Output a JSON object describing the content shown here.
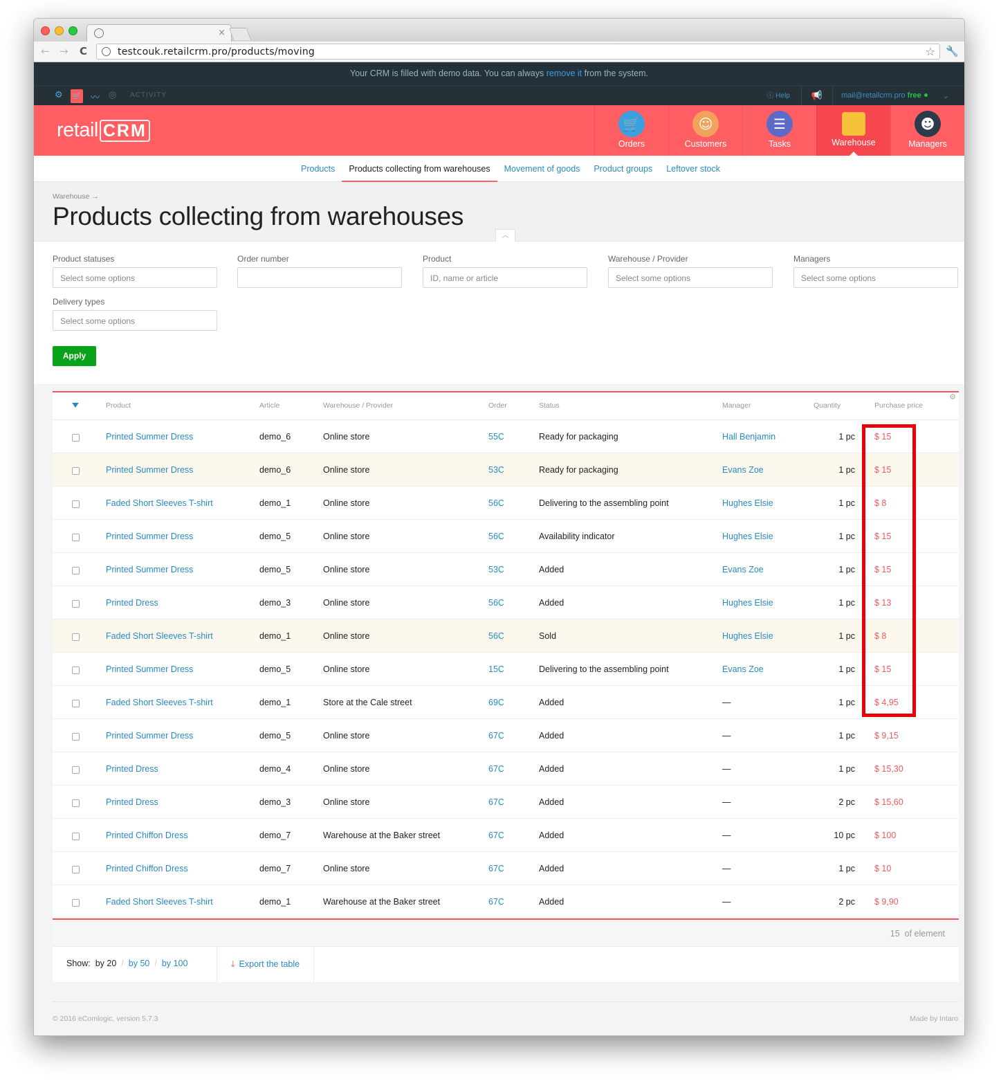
{
  "browser": {
    "url": "testcouk.retailcrm.pro/products/moving",
    "tab_close": "×"
  },
  "demo_banner": {
    "text_before": "Your CRM is filled with demo data. You can always ",
    "link": "remove it",
    "text_after": " from the system."
  },
  "topbar": {
    "activity": "ACTIVITY",
    "help": "Help",
    "user_email": "mail@retailcrm.pro",
    "plan": "free"
  },
  "header": {
    "logo_text": "retail",
    "logo_crm": "CRM",
    "nav": [
      {
        "label": "Orders",
        "icon": "cart-icon"
      },
      {
        "label": "Customers",
        "icon": "customer-avatar-icon"
      },
      {
        "label": "Tasks",
        "icon": "tasks-icon"
      },
      {
        "label": "Warehouse",
        "icon": "box-icon",
        "active": true
      },
      {
        "label": "Managers",
        "icon": "manager-avatar-icon"
      }
    ]
  },
  "subnav": [
    {
      "label": "Products"
    },
    {
      "label": "Products collecting from warehouses",
      "active": true
    },
    {
      "label": "Movement of goods"
    },
    {
      "label": "Product groups"
    },
    {
      "label": "Leftover stock"
    }
  ],
  "page": {
    "breadcrumb": "Warehouse →",
    "title": "Products collecting from warehouses"
  },
  "filters": {
    "product_statuses": {
      "label": "Product statuses",
      "placeholder": "Select some options"
    },
    "order_number": {
      "label": "Order number",
      "placeholder": ""
    },
    "product": {
      "label": "Product",
      "placeholder": "ID, name or article"
    },
    "warehouse": {
      "label": "Warehouse / Provider",
      "placeholder": "Select some options"
    },
    "managers": {
      "label": "Managers",
      "placeholder": "Select some options"
    },
    "delivery_types": {
      "label": "Delivery types",
      "placeholder": "Select some options"
    },
    "apply": "Apply"
  },
  "table": {
    "headers": {
      "product": "Product",
      "article": "Article",
      "warehouse": "Warehouse / Provider",
      "order": "Order",
      "status": "Status",
      "manager": "Manager",
      "quantity": "Quantity",
      "price": "Purchase price"
    },
    "rows": [
      {
        "product": "Printed Summer Dress",
        "article": "demo_6",
        "warehouse": "Online store",
        "order": "55C",
        "status": "Ready for packaging",
        "manager": "Hall Benjamin",
        "quantity": "1 pc",
        "price": "$ 15"
      },
      {
        "product": "Printed Summer Dress",
        "article": "demo_6",
        "warehouse": "Online store",
        "order": "53C",
        "status": "Ready for packaging",
        "manager": "Evans Zoe",
        "quantity": "1 pc",
        "price": "$ 15"
      },
      {
        "product": "Faded Short Sleeves T-shirt",
        "article": "demo_1",
        "warehouse": "Online store",
        "order": "56C",
        "status": "Delivering to the assembling point",
        "manager": "Hughes Elsie",
        "quantity": "1 pc",
        "price": "$ 8"
      },
      {
        "product": "Printed Summer Dress",
        "article": "demo_5",
        "warehouse": "Online store",
        "order": "56C",
        "status": "Availability indicator",
        "manager": "Hughes Elsie",
        "quantity": "1 pc",
        "price": "$ 15"
      },
      {
        "product": "Printed Summer Dress",
        "article": "demo_5",
        "warehouse": "Online store",
        "order": "53C",
        "status": "Added",
        "manager": "Evans Zoe",
        "quantity": "1 pc",
        "price": "$ 15"
      },
      {
        "product": "Printed Dress",
        "article": "demo_3",
        "warehouse": "Online store",
        "order": "56C",
        "status": "Added",
        "manager": "Hughes Elsie",
        "quantity": "1 pc",
        "price": "$ 13"
      },
      {
        "product": "Faded Short Sleeves T-shirt",
        "article": "demo_1",
        "warehouse": "Online store",
        "order": "56C",
        "status": "Sold",
        "manager": "Hughes Elsie",
        "quantity": "1 pc",
        "price": "$ 8"
      },
      {
        "product": "Printed Summer Dress",
        "article": "demo_5",
        "warehouse": "Online store",
        "order": "15C",
        "status": "Delivering to the assembling point",
        "manager": "Evans Zoe",
        "quantity": "1 pc",
        "price": "$ 15"
      },
      {
        "product": "Faded Short Sleeves T-shirt",
        "article": "demo_1",
        "warehouse": "Store at the Cale street",
        "order": "69C",
        "status": "Added",
        "manager": "—",
        "quantity": "1 pc",
        "price": "$ 4,95"
      },
      {
        "product": "Printed Summer Dress",
        "article": "demo_5",
        "warehouse": "Online store",
        "order": "67C",
        "status": "Added",
        "manager": "—",
        "quantity": "1 pc",
        "price": "$ 9,15"
      },
      {
        "product": "Printed Dress",
        "article": "demo_4",
        "warehouse": "Online store",
        "order": "67C",
        "status": "Added",
        "manager": "—",
        "quantity": "1 pc",
        "price": "$ 15,30"
      },
      {
        "product": "Printed Dress",
        "article": "demo_3",
        "warehouse": "Online store",
        "order": "67C",
        "status": "Added",
        "manager": "—",
        "quantity": "2 pc",
        "price": "$ 15,60"
      },
      {
        "product": "Printed Chiffon Dress",
        "article": "demo_7",
        "warehouse": "Warehouse at the Baker street",
        "order": "67C",
        "status": "Added",
        "manager": "—",
        "quantity": "10 pc",
        "price": "$ 100"
      },
      {
        "product": "Printed Chiffon Dress",
        "article": "demo_7",
        "warehouse": "Online store",
        "order": "67C",
        "status": "Added",
        "manager": "—",
        "quantity": "1 pc",
        "price": "$ 10"
      },
      {
        "product": "Faded Short Sleeves T-shirt",
        "article": "demo_1",
        "warehouse": "Warehouse at the Baker street",
        "order": "67C",
        "status": "Added",
        "manager": "—",
        "quantity": "2 pc",
        "price": "$ 9,90"
      }
    ],
    "count": "15",
    "count_suffix": "of element"
  },
  "pagination": {
    "show_label": "Show:",
    "options": [
      "by 20",
      "by 50",
      "by 100"
    ],
    "export_label": "Export the table"
  },
  "footer": {
    "copyright": "© 2016 eComlogic, version 5.7.3",
    "made_by": "Made by Intaro"
  },
  "colors": {
    "brand_red": "#ff5e62",
    "link_blue": "#2a8bc3",
    "apply_green": "#0aa11b",
    "annotation_red": "#e8000b"
  }
}
